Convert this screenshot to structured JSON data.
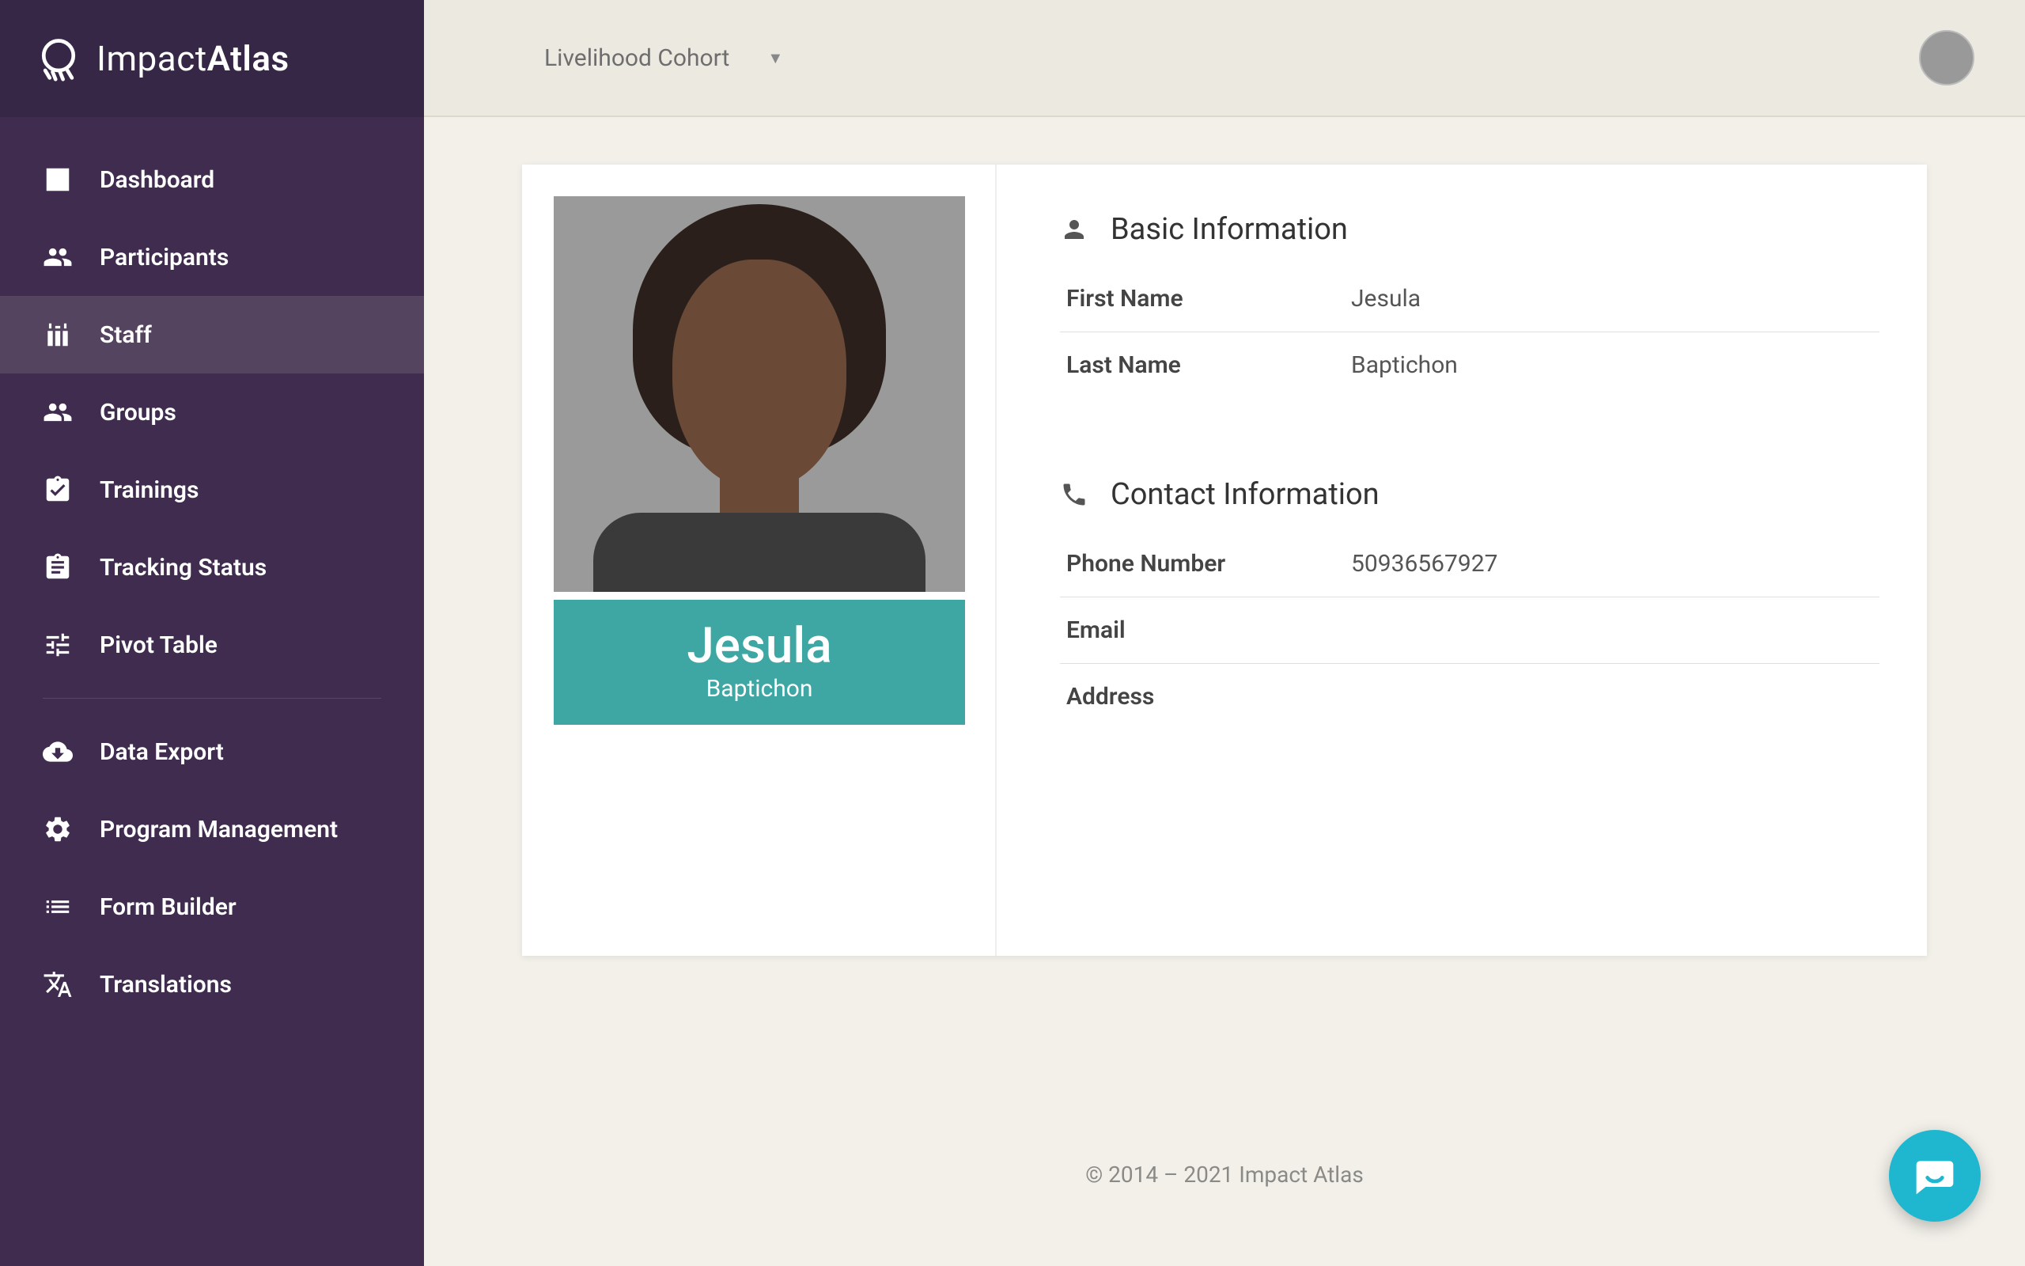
{
  "brand": {
    "name1": "Impact",
    "name2": "Atlas"
  },
  "sidebar": {
    "items": [
      {
        "label": "Dashboard"
      },
      {
        "label": "Participants"
      },
      {
        "label": "Staff"
      },
      {
        "label": "Groups"
      },
      {
        "label": "Trainings"
      },
      {
        "label": "Tracking Status"
      },
      {
        "label": "Pivot Table"
      },
      {
        "label": "Data Export"
      },
      {
        "label": "Program Management"
      },
      {
        "label": "Form Builder"
      },
      {
        "label": "Translations"
      }
    ]
  },
  "topbar": {
    "program": "Livelihood Cohort"
  },
  "profile": {
    "firstName": "Jesula",
    "lastName": "Baptichon"
  },
  "sections": {
    "basic": {
      "title": "Basic Information",
      "rows": {
        "firstNameLabel": "First Name",
        "lastNameLabel": "Last Name"
      }
    },
    "contact": {
      "title": "Contact Information",
      "rows": {
        "phoneLabel": "Phone Number",
        "phoneValue": "50936567927",
        "emailLabel": "Email",
        "emailValue": "",
        "addressLabel": "Address",
        "addressValue": ""
      }
    }
  },
  "footer": "© 2014 – 2021 Impact Atlas"
}
